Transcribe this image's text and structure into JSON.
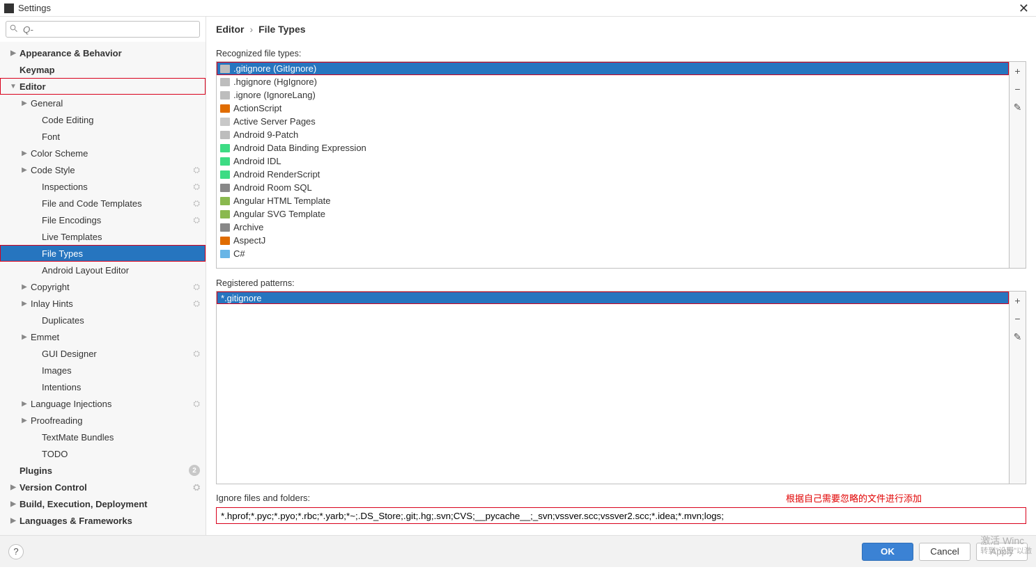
{
  "window": {
    "title": "Settings"
  },
  "search": {
    "placeholder": "Q-"
  },
  "sidebar": [
    {
      "lvl": 0,
      "arrow": "▶",
      "label": "Appearance & Behavior",
      "gear": false
    },
    {
      "lvl": 1,
      "arrow": "",
      "label": "Keymap",
      "gear": false,
      "bold": true,
      "pad0": true
    },
    {
      "lvl": 0,
      "arrow": "▼",
      "label": "Editor",
      "gear": false,
      "red": true
    },
    {
      "lvl": 1,
      "arrow": "▶",
      "label": "General",
      "gear": false
    },
    {
      "lvl": 2,
      "arrow": "",
      "label": "Code Editing",
      "gear": false,
      "leaf": true
    },
    {
      "lvl": 2,
      "arrow": "",
      "label": "Font",
      "gear": false,
      "leaf": true
    },
    {
      "lvl": 1,
      "arrow": "▶",
      "label": "Color Scheme",
      "gear": false
    },
    {
      "lvl": 1,
      "arrow": "▶",
      "label": "Code Style",
      "gear": true
    },
    {
      "lvl": 2,
      "arrow": "",
      "label": "Inspections",
      "gear": true,
      "leaf": true
    },
    {
      "lvl": 2,
      "arrow": "",
      "label": "File and Code Templates",
      "gear": true,
      "leaf": true
    },
    {
      "lvl": 2,
      "arrow": "",
      "label": "File Encodings",
      "gear": true,
      "leaf": true
    },
    {
      "lvl": 2,
      "arrow": "",
      "label": "Live Templates",
      "gear": false,
      "leaf": true
    },
    {
      "lvl": 2,
      "arrow": "",
      "label": "File Types",
      "gear": false,
      "sel": true,
      "red": true,
      "leaf": true
    },
    {
      "lvl": 2,
      "arrow": "",
      "label": "Android Layout Editor",
      "gear": false,
      "leaf": true
    },
    {
      "lvl": 1,
      "arrow": "▶",
      "label": "Copyright",
      "gear": true
    },
    {
      "lvl": 1,
      "arrow": "▶",
      "label": "Inlay Hints",
      "gear": true
    },
    {
      "lvl": 2,
      "arrow": "",
      "label": "Duplicates",
      "gear": false,
      "leaf": true
    },
    {
      "lvl": 1,
      "arrow": "▶",
      "label": "Emmet",
      "gear": false
    },
    {
      "lvl": 2,
      "arrow": "",
      "label": "GUI Designer",
      "gear": true,
      "leaf": true
    },
    {
      "lvl": 2,
      "arrow": "",
      "label": "Images",
      "gear": false,
      "leaf": true
    },
    {
      "lvl": 2,
      "arrow": "",
      "label": "Intentions",
      "gear": false,
      "leaf": true
    },
    {
      "lvl": 1,
      "arrow": "▶",
      "label": "Language Injections",
      "gear": true
    },
    {
      "lvl": 1,
      "arrow": "▶",
      "label": "Proofreading",
      "gear": false
    },
    {
      "lvl": 2,
      "arrow": "",
      "label": "TextMate Bundles",
      "gear": false,
      "leaf": true
    },
    {
      "lvl": 2,
      "arrow": "",
      "label": "TODO",
      "gear": false,
      "leaf": true
    },
    {
      "lvl": 0,
      "arrow": "",
      "label": "Plugins",
      "gear": false,
      "badge": "2",
      "noarrow": true
    },
    {
      "lvl": 0,
      "arrow": "▶",
      "label": "Version Control",
      "gear": true
    },
    {
      "lvl": 0,
      "arrow": "▶",
      "label": "Build, Execution, Deployment",
      "gear": false
    },
    {
      "lvl": 0,
      "arrow": "▶",
      "label": "Languages & Frameworks",
      "gear": false
    }
  ],
  "breadcrumb": {
    "a": "Editor",
    "sep": "›",
    "b": "File Types"
  },
  "labels": {
    "recognized": "Recognized file types:",
    "registered": "Registered patterns:",
    "ignore_label": "Ignore files and folders:",
    "red_note": "根据自己需要忽略的文件进行添加"
  },
  "file_types": [
    {
      "label": ".gitignore (GitIgnore)",
      "cls": "fi-gray",
      "sel": true,
      "red": true
    },
    {
      "label": ".hgignore (HgIgnore)",
      "cls": "fi-gray"
    },
    {
      "label": ".ignore (IgnoreLang)",
      "cls": "fi-gray"
    },
    {
      "label": "ActionScript",
      "cls": "fi-as"
    },
    {
      "label": "Active Server Pages",
      "cls": "fi-generic"
    },
    {
      "label": "Android 9-Patch",
      "cls": "fi-gray"
    },
    {
      "label": "Android Data Binding Expression",
      "cls": "fi-android"
    },
    {
      "label": "Android IDL",
      "cls": "fi-android"
    },
    {
      "label": "Android RenderScript",
      "cls": "fi-android"
    },
    {
      "label": "Android Room SQL",
      "cls": "fi-archive"
    },
    {
      "label": "Angular HTML Template",
      "cls": "fi-h"
    },
    {
      "label": "Angular SVG Template",
      "cls": "fi-h"
    },
    {
      "label": "Archive",
      "cls": "fi-archive"
    },
    {
      "label": "AspectJ",
      "cls": "fi-aj"
    },
    {
      "label": "C#",
      "cls": "fi-cs"
    }
  ],
  "patterns": [
    {
      "label": "*.gitignore",
      "sel": true,
      "red": true
    }
  ],
  "ignore_value": "*.hprof;*.pyc;*.pyo;*.rbc;*.yarb;*~;.DS_Store;.git;.hg;.svn;CVS;__pycache__;_svn;vssver.scc;vssver2.scc;*.idea;*.mvn;logs;",
  "buttons": {
    "ok": "OK",
    "cancel": "Cancel",
    "apply": "Apply"
  },
  "watermark": {
    "l1": "激活 Winc",
    "l2": "转到\"设置\"以激"
  },
  "side_icons": {
    "add": "+",
    "remove": "−",
    "edit": "✎"
  }
}
